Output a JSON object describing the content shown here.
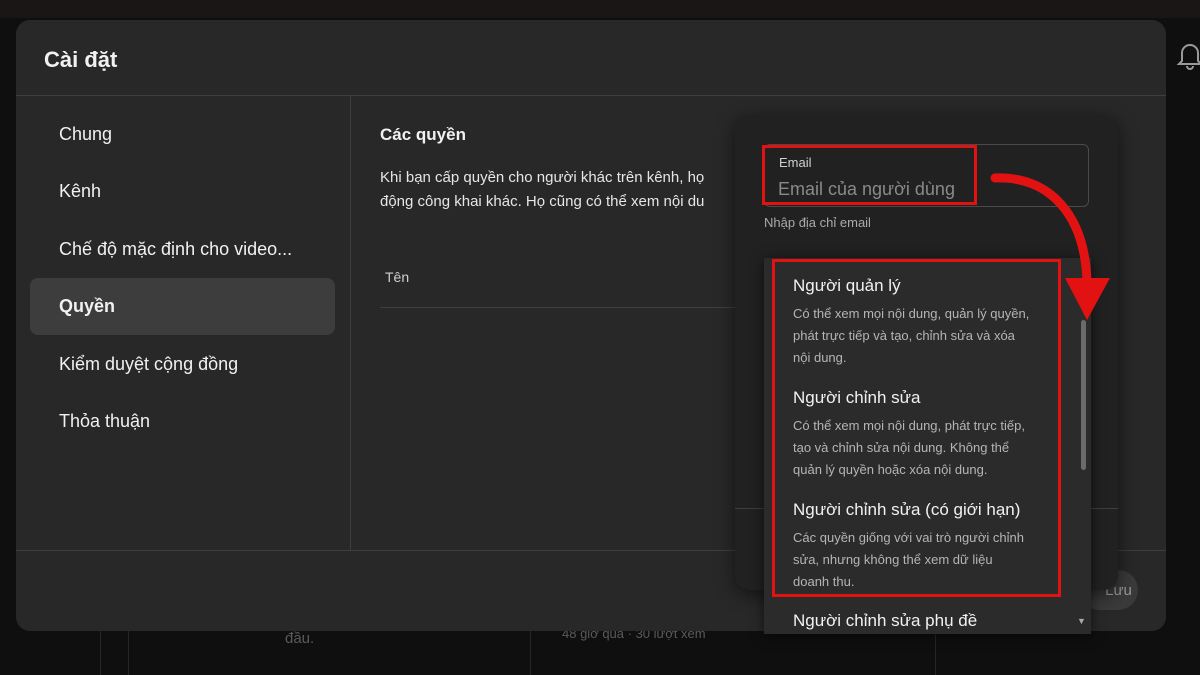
{
  "dialog": {
    "title": "Cài đặt"
  },
  "nav": {
    "items": [
      {
        "label": "Chung",
        "active": false
      },
      {
        "label": "Kênh",
        "active": false
      },
      {
        "label": "Chế độ mặc định cho video...",
        "active": false
      },
      {
        "label": "Quyền",
        "active": true
      },
      {
        "label": "Kiểm duyệt cộng đồng",
        "active": false
      },
      {
        "label": "Thỏa thuận",
        "active": false
      }
    ]
  },
  "permissions": {
    "title": "Các quyền",
    "description_line1": "Khi bạn cấp quyền cho người khác trên kênh, họ",
    "description_line2": "động công khai khác. Họ cũng có thể xem nội du",
    "column_name": "Tên"
  },
  "invite": {
    "email_label": "Email",
    "email_placeholder": "Email của người dùng",
    "email_hint": "Nhập địa chỉ email"
  },
  "roles": [
    {
      "title": "Người quản lý",
      "desc": [
        "Có thể xem mọi nội dung, quản lý quyền,",
        "phát trực tiếp và tạo, chỉnh sửa và xóa",
        "nội dung."
      ]
    },
    {
      "title": "Người chỉnh sửa",
      "desc": [
        "Có thể xem mọi nội dung, phát trực tiếp,",
        "tạo và chỉnh sửa nội dung. Không thể",
        "quản lý quyền hoặc xóa nội dung."
      ]
    },
    {
      "title": "Người chỉnh sửa (có giới hạn)",
      "desc": [
        "Các quyền giống với vai trò người chỉnh",
        "sửa, nhưng không thể xem dữ liệu",
        "doanh thu."
      ]
    },
    {
      "title": "Người chỉnh sửa phụ đề",
      "desc": []
    }
  ],
  "footer": {
    "save_label": "Lưu"
  },
  "background": {
    "text_left": "đầu.",
    "text_right": "48 giờ qua · 30 lượt xem"
  },
  "colors": {
    "annotation": "#e21212",
    "dialog_bg": "#282828",
    "dropdown_bg": "#2b2b2b"
  }
}
